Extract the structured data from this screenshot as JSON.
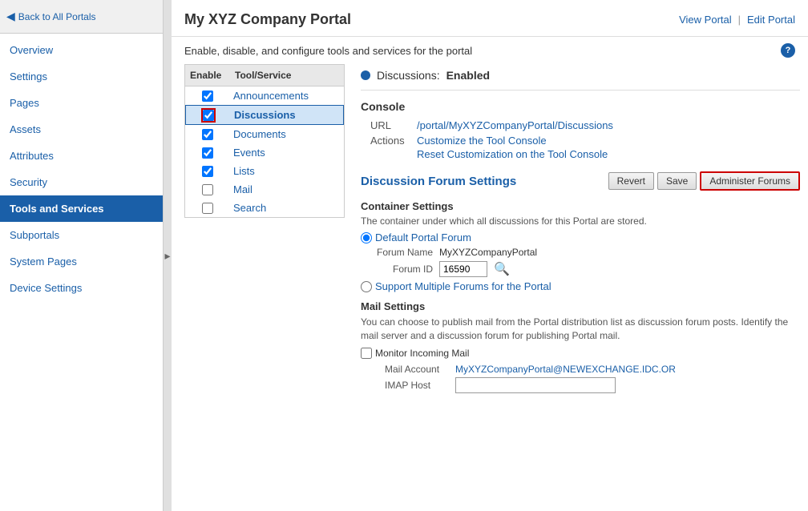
{
  "header": {
    "back_label": "Back to All Portals",
    "page_title": "My XYZ Company Portal",
    "view_portal_label": "View Portal",
    "edit_portal_label": "Edit Portal",
    "separator": "|"
  },
  "sub_header": {
    "description": "Enable, disable, and configure tools and services for the portal"
  },
  "sidebar": {
    "items": [
      {
        "id": "overview",
        "label": "Overview",
        "active": false
      },
      {
        "id": "settings",
        "label": "Settings",
        "active": false
      },
      {
        "id": "pages",
        "label": "Pages",
        "active": false
      },
      {
        "id": "assets",
        "label": "Assets",
        "active": false
      },
      {
        "id": "attributes",
        "label": "Attributes",
        "active": false
      },
      {
        "id": "security",
        "label": "Security",
        "active": false
      },
      {
        "id": "tools-and-services",
        "label": "Tools and Services",
        "active": true
      },
      {
        "id": "subportals",
        "label": "Subportals",
        "active": false
      },
      {
        "id": "system-pages",
        "label": "System Pages",
        "active": false
      },
      {
        "id": "device-settings",
        "label": "Device Settings",
        "active": false
      }
    ]
  },
  "tool_list": {
    "header_enable": "Enable",
    "header_tool": "Tool/Service",
    "items": [
      {
        "name": "Announcements",
        "enabled": true,
        "selected": false
      },
      {
        "name": "Discussions",
        "enabled": true,
        "selected": true
      },
      {
        "name": "Documents",
        "enabled": true,
        "selected": false
      },
      {
        "name": "Events",
        "enabled": true,
        "selected": false
      },
      {
        "name": "Lists",
        "enabled": true,
        "selected": false
      },
      {
        "name": "Mail",
        "enabled": false,
        "selected": false
      },
      {
        "name": "Search",
        "enabled": false,
        "selected": false
      }
    ]
  },
  "detail": {
    "status_label": "Discussions:",
    "status_value": "Enabled",
    "console": {
      "title": "Console",
      "url_label": "URL",
      "url_value": "/portal/MyXYZCompanyPortal/Discussions",
      "actions_label": "Actions",
      "action1": "Customize the Tool Console",
      "action2": "Reset Customization on the Tool Console"
    },
    "forum_settings": {
      "title": "Discussion Forum Settings",
      "revert_label": "Revert",
      "save_label": "Save",
      "administer_label": "Administer Forums",
      "container": {
        "title": "Container Settings",
        "description": "The container under which all discussions for this Portal are stored.",
        "default_option": "Default Portal Forum",
        "forum_name_label": "Forum Name",
        "forum_name_value": "MyXYZCompanyPortal",
        "forum_id_label": "Forum ID",
        "forum_id_value": "16590",
        "support_option": "Support Multiple Forums for the Portal"
      },
      "mail": {
        "title": "Mail Settings",
        "description": "You can choose to publish mail from the Portal distribution list as discussion forum posts. Identify the mail server and a discussion forum for publishing Portal mail.",
        "monitor_label": "Monitor Incoming Mail",
        "mail_account_label": "Mail Account",
        "mail_account_value": "MyXYZCompanyPortal@NEWEXCHANGE.IDC.OR",
        "imap_host_label": "IMAP Host",
        "imap_host_value": ""
      }
    }
  }
}
